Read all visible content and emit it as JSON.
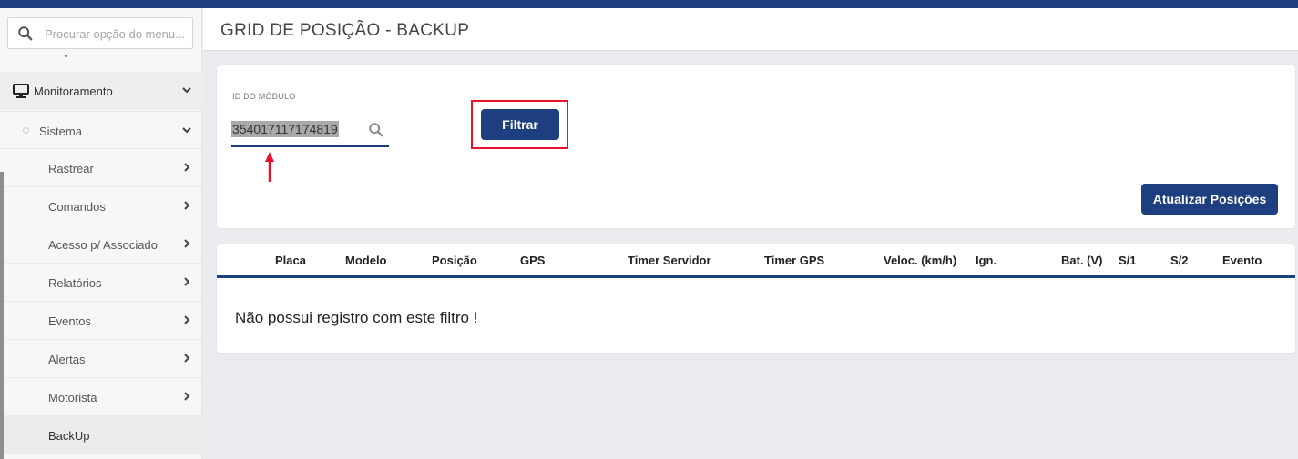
{
  "app": {
    "accent_color": "#1d3f7f",
    "highlight_color": "#e8112d"
  },
  "sidebar": {
    "search": {
      "placeholder": "Procurar opção do menu...",
      "icon": "search-icon"
    },
    "section": {
      "label": "Monitoramento",
      "icon": "monitor-icon",
      "expanded": true
    },
    "group": {
      "label": "Sistema",
      "expanded": true
    },
    "items": [
      {
        "label": "Rastrear",
        "has_submenu": true
      },
      {
        "label": "Comandos",
        "has_submenu": true
      },
      {
        "label": "Acesso p/ Associado",
        "has_submenu": true
      },
      {
        "label": "Relatórios",
        "has_submenu": true
      },
      {
        "label": "Eventos",
        "has_submenu": true
      },
      {
        "label": "Alertas",
        "has_submenu": true
      },
      {
        "label": "Motorista",
        "has_submenu": true
      },
      {
        "label": "BackUp",
        "has_submenu": false,
        "active": true
      }
    ]
  },
  "header": {
    "title": "GRID DE POSIÇÃO - BACKUP"
  },
  "filter": {
    "field_label": "ID DO MÓDULO",
    "value": "354017117174819",
    "filter_button": "Filtrar",
    "update_button": "Atualizar Posições"
  },
  "table": {
    "columns": [
      "Placa",
      "Modelo",
      "Posição",
      "GPS",
      "Timer Servidor",
      "Timer GPS",
      "Veloc. (km/h)",
      "Ign.",
      "Bat. (V)",
      "S/1",
      "S/2",
      "Evento"
    ],
    "rows": [],
    "empty_message": "Não possui registro com este filtro !"
  }
}
